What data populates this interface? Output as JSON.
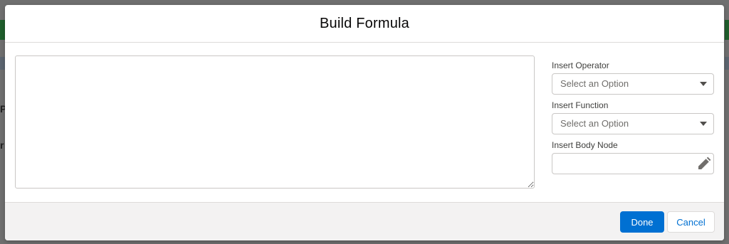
{
  "backdrop": {
    "letters": [
      "P",
      "r"
    ]
  },
  "modal": {
    "title": "Build Formula",
    "formula": {
      "value": ""
    },
    "fields": {
      "operator": {
        "label": "Insert Operator",
        "value": "Select an Option"
      },
      "function": {
        "label": "Insert Function",
        "value": "Select an Option"
      },
      "body_node": {
        "label": "Insert Body Node",
        "value": ""
      }
    },
    "footer": {
      "done_label": "Done",
      "cancel_label": "Cancel"
    }
  },
  "colors": {
    "brand": "#0070d2",
    "footer_bg": "#f3f2f2",
    "border": "#c9c7c5"
  },
  "icons": {
    "select_caret": "chevron-down-icon",
    "edit": "pencil-icon"
  }
}
